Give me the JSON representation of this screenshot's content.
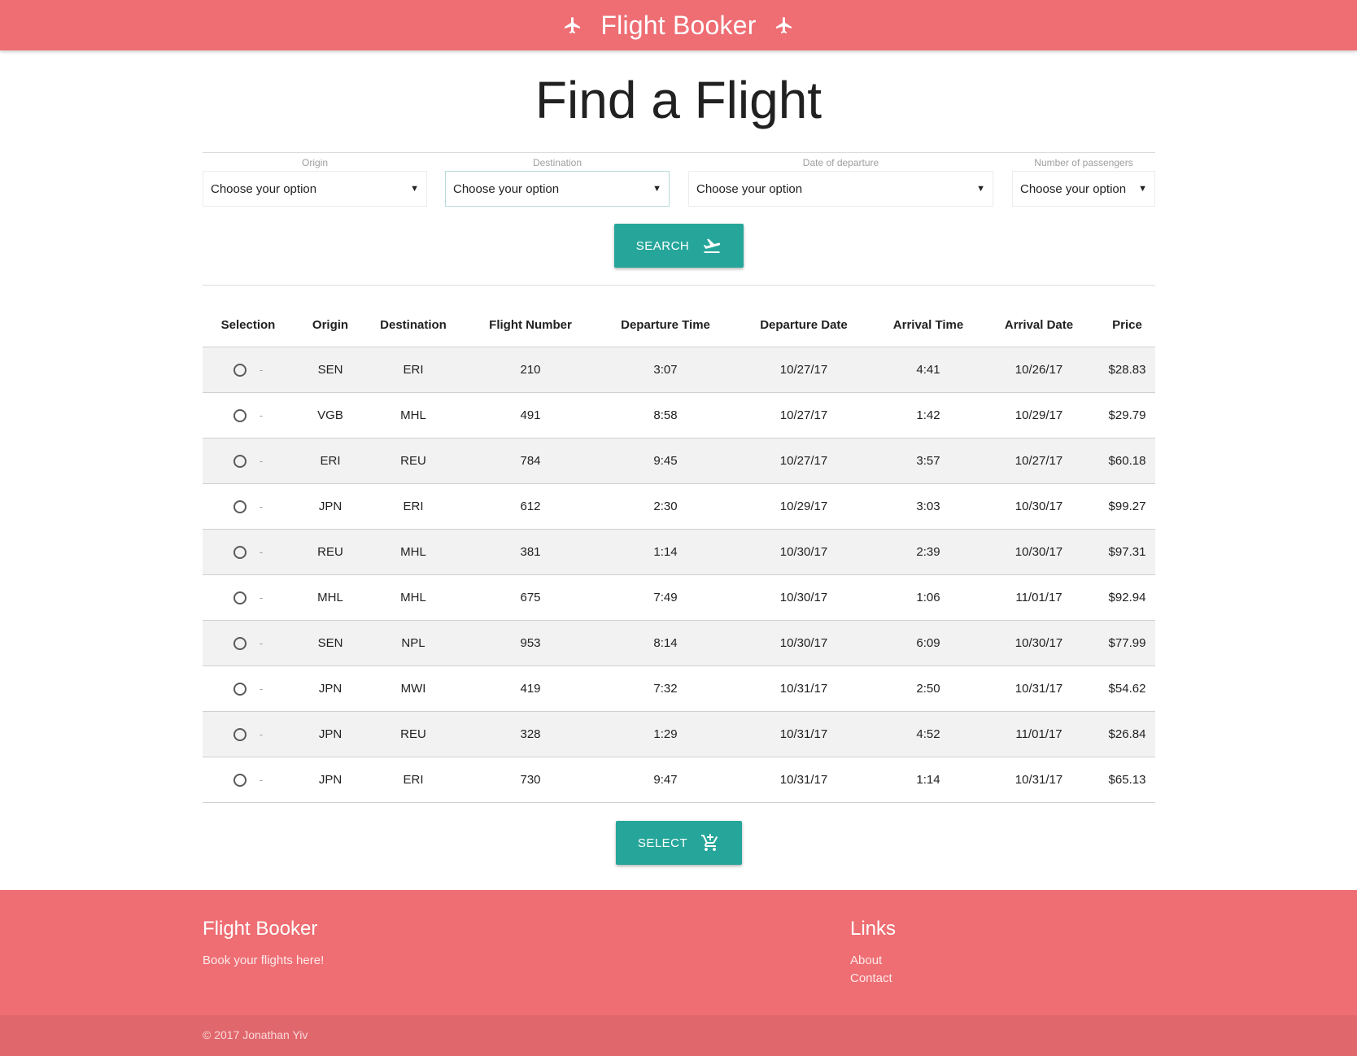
{
  "header": {
    "title": "Flight Booker",
    "left_icon": "airplane-icon",
    "right_icon": "airplane-icon"
  },
  "page_title": "Find a Flight",
  "filters": {
    "origin": {
      "label": "Origin",
      "value": "Choose your option"
    },
    "destination": {
      "label": "Destination",
      "value": "Choose your option"
    },
    "date": {
      "label": "Date of departure",
      "value": "Choose your option"
    },
    "passengers": {
      "label": "Number of passengers",
      "value": "Choose your option"
    }
  },
  "search_button": {
    "label": "SEARCH",
    "icon": "flight-takeoff-icon"
  },
  "table": {
    "columns": [
      "Selection",
      "Origin",
      "Destination",
      "Flight Number",
      "Departure Time",
      "Departure Date",
      "Arrival Time",
      "Arrival Date",
      "Price"
    ],
    "selection_placeholder": "-",
    "rows": [
      [
        "SEN",
        "ERI",
        "210",
        "3:07",
        "10/27/17",
        "4:41",
        "10/26/17",
        "$28.83"
      ],
      [
        "VGB",
        "MHL",
        "491",
        "8:58",
        "10/27/17",
        "1:42",
        "10/29/17",
        "$29.79"
      ],
      [
        "ERI",
        "REU",
        "784",
        "9:45",
        "10/27/17",
        "3:57",
        "10/27/17",
        "$60.18"
      ],
      [
        "JPN",
        "ERI",
        "612",
        "2:30",
        "10/29/17",
        "3:03",
        "10/30/17",
        "$99.27"
      ],
      [
        "REU",
        "MHL",
        "381",
        "1:14",
        "10/30/17",
        "2:39",
        "10/30/17",
        "$97.31"
      ],
      [
        "MHL",
        "MHL",
        "675",
        "7:49",
        "10/30/17",
        "1:06",
        "11/01/17",
        "$92.94"
      ],
      [
        "SEN",
        "NPL",
        "953",
        "8:14",
        "10/30/17",
        "6:09",
        "10/30/17",
        "$77.99"
      ],
      [
        "JPN",
        "MWI",
        "419",
        "7:32",
        "10/31/17",
        "2:50",
        "10/31/17",
        "$54.62"
      ],
      [
        "JPN",
        "REU",
        "328",
        "1:29",
        "10/31/17",
        "4:52",
        "11/01/17",
        "$26.84"
      ],
      [
        "JPN",
        "ERI",
        "730",
        "9:47",
        "10/31/17",
        "1:14",
        "10/31/17",
        "$65.13"
      ]
    ]
  },
  "select_button": {
    "label": "SELECT",
    "icon": "add-shopping-cart-icon"
  },
  "footer": {
    "title": "Flight Booker",
    "tagline": "Book your flights here!",
    "links_title": "Links",
    "links": [
      "About",
      "Contact"
    ],
    "copyright": "© 2017 Jonathan Yiv"
  },
  "colors": {
    "brand": "#ee6e73",
    "accent": "#26a69a",
    "copy_bar": "#e0676c"
  }
}
